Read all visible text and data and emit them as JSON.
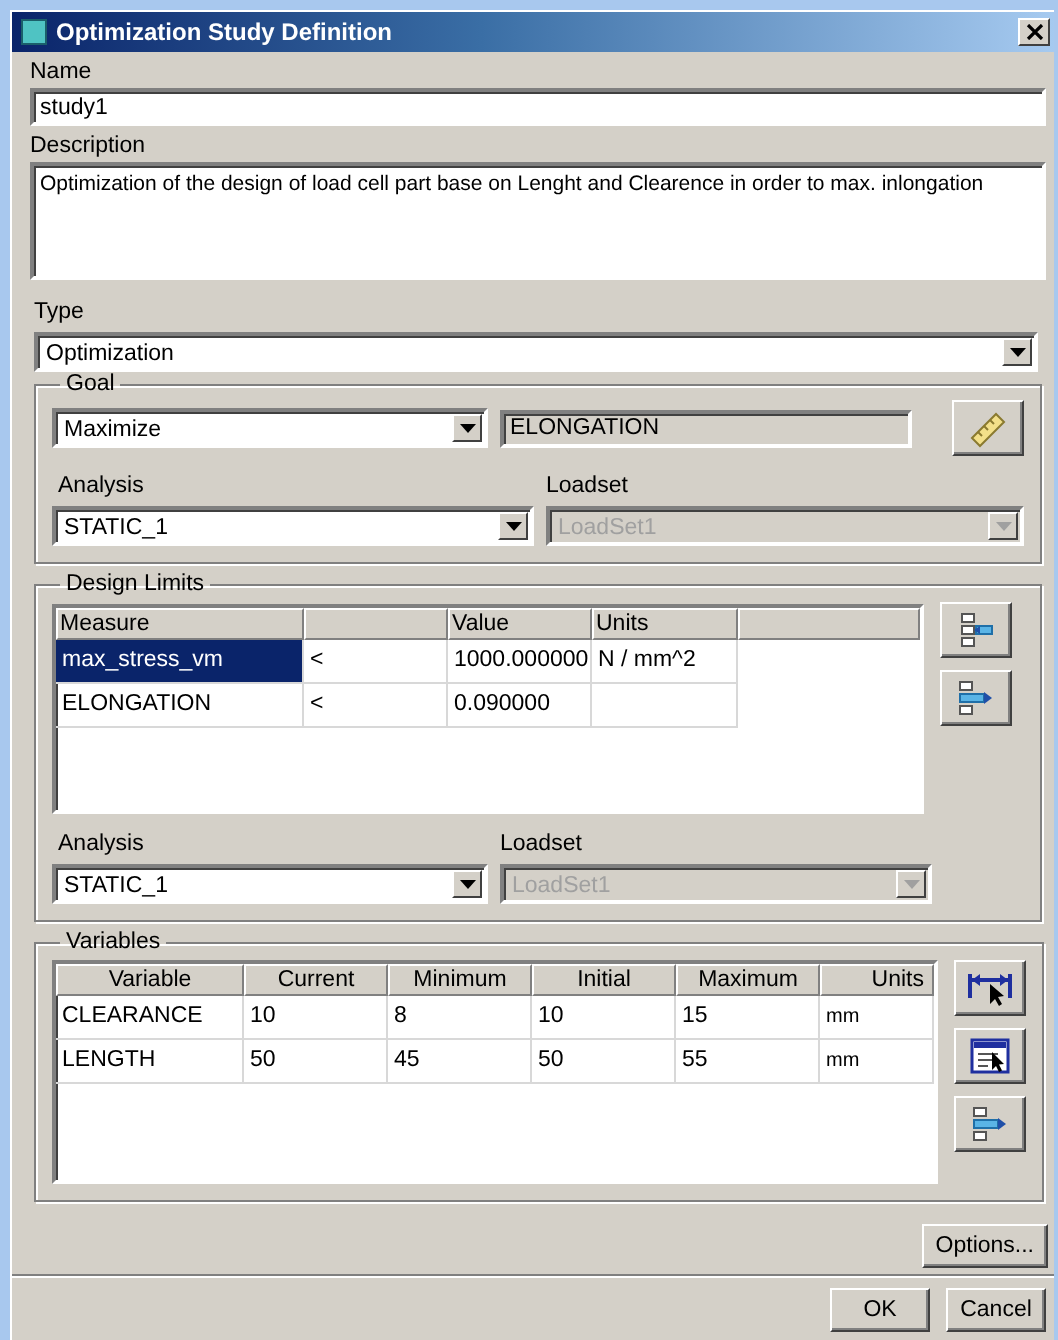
{
  "window": {
    "title": "Optimization Study Definition"
  },
  "name": {
    "label": "Name",
    "value": "study1"
  },
  "description": {
    "label": "Description",
    "value": "Optimization of the design of load cell part base on Lenght and Clearence in order to max. inlongation"
  },
  "type": {
    "label": "Type",
    "value": "Optimization",
    "disabled": false
  },
  "goal": {
    "title": "Goal",
    "objective": {
      "value": "Maximize",
      "disabled": false
    },
    "measure": {
      "value": "ELONGATION",
      "readonly": true
    },
    "analysis": {
      "label": "Analysis",
      "value": "STATIC_1",
      "disabled": false
    },
    "loadset": {
      "label": "Loadset",
      "value": "LoadSet1",
      "disabled": true
    }
  },
  "design_limits": {
    "title": "Design Limits",
    "columns": [
      "Measure",
      "Value",
      "Units"
    ],
    "rows": [
      {
        "measure": "max_stress_vm",
        "relation": "<",
        "value": "1000.000000",
        "units": "N / mm^2",
        "selected": true
      },
      {
        "measure": "ELONGATION",
        "relation": "<",
        "value": "0.090000",
        "selected": false
      }
    ],
    "analysis": {
      "label": "Analysis",
      "value": "STATIC_1",
      "disabled": false
    },
    "loadset": {
      "label": "Loadset",
      "value": "LoadSet1",
      "disabled": true
    }
  },
  "variables": {
    "title": "Variables",
    "columns": [
      "Variable",
      "Current",
      "Minimum",
      "Initial",
      "Maximum",
      "Units"
    ],
    "rows": [
      [
        "CLEARANCE",
        "10",
        "8",
        "10",
        "15",
        "mm"
      ],
      [
        "LENGTH",
        "50",
        "45",
        "50",
        "55",
        "mm"
      ]
    ]
  },
  "buttons": {
    "options": "Options...",
    "ok": "OK",
    "cancel": "Cancel"
  }
}
